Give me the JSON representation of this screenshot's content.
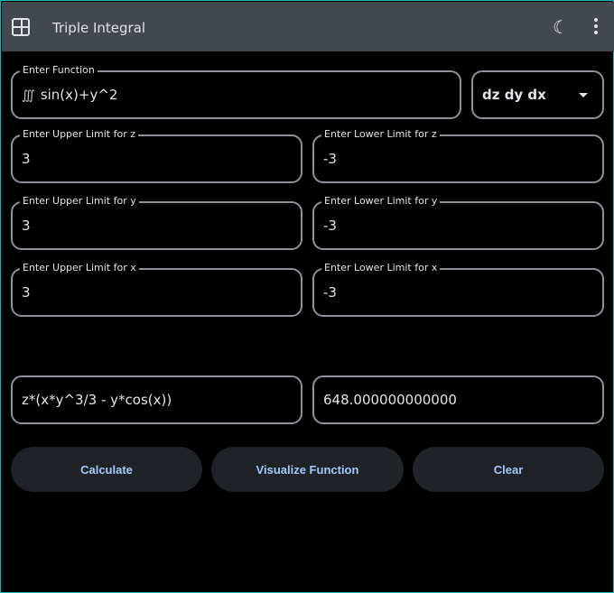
{
  "header": {
    "title": "Triple Integral",
    "app_icon": "calculator-icon",
    "theme_icon": "moon-icon",
    "menu_icon": "more-vert-icon"
  },
  "function": {
    "label": "Enter Function",
    "symbol": "∭",
    "value": "sin(x)+y^2"
  },
  "order": {
    "selected": "dz dy dx"
  },
  "limits": {
    "z_upper": {
      "label": "Enter Upper Limit for z",
      "value": "3"
    },
    "z_lower": {
      "label": "Enter Lower Limit for z",
      "value": "-3"
    },
    "y_upper": {
      "label": "Enter Upper Limit for y",
      "value": "3"
    },
    "y_lower": {
      "label": "Enter Lower Limit for y",
      "value": "-3"
    },
    "x_upper": {
      "label": "Enter Upper Limit for x",
      "value": "3"
    },
    "x_lower": {
      "label": "Enter Lower Limit for x",
      "value": "-3"
    }
  },
  "results": {
    "antiderivative": "z*(x*y^3/3 - y*cos(x))",
    "value": "648.000000000000"
  },
  "buttons": {
    "calculate": "Calculate",
    "visualize": "Visualize Function",
    "clear": "Clear"
  }
}
